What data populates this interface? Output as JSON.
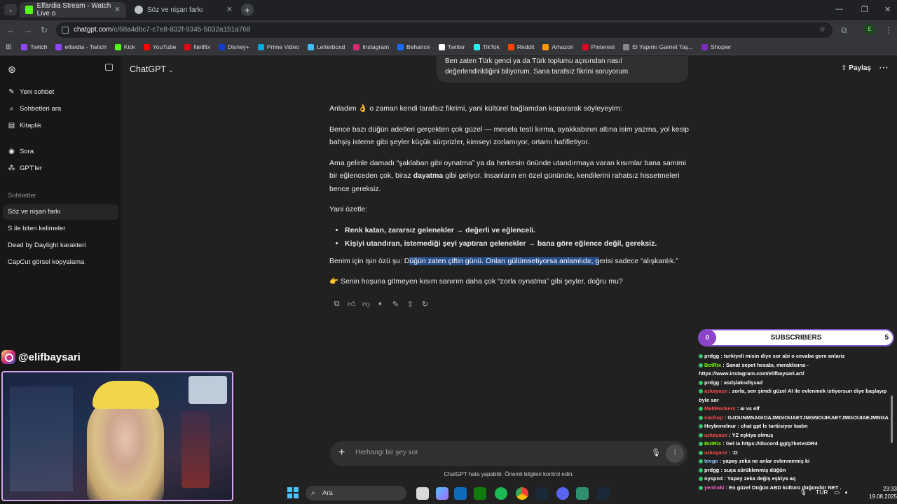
{
  "browser": {
    "tabs": [
      {
        "title": "Elfardia Stream - Watch Live o",
        "active": true
      },
      {
        "title": "Söz ve nişan farkı",
        "active": false
      }
    ],
    "url_host": "chatgpt.com",
    "url_path": "/c/68a4dbc7-c7e8-832f-9345-5032a151a768",
    "profile_initial": "E",
    "bookmarks": [
      {
        "label": "Twitch",
        "color": "#9146ff"
      },
      {
        "label": "elfardia - Twitch",
        "color": "#9146ff"
      },
      {
        "label": "Kick",
        "color": "#53fc18"
      },
      {
        "label": "YouTube",
        "color": "#ff0000"
      },
      {
        "label": "Netflix",
        "color": "#e50914"
      },
      {
        "label": "Disney+",
        "color": "#113ccf"
      },
      {
        "label": "Prime Video",
        "color": "#00a8e1"
      },
      {
        "label": "Letterboxd",
        "color": "#40bcf4"
      },
      {
        "label": "Instagram",
        "color": "#d62976"
      },
      {
        "label": "Behance",
        "color": "#1769ff"
      },
      {
        "label": "Twitter",
        "color": "#ffffff"
      },
      {
        "label": "TikTok",
        "color": "#25f4ee"
      },
      {
        "label": "Reddit",
        "color": "#ff4500"
      },
      {
        "label": "Amazon",
        "color": "#ff9900"
      },
      {
        "label": "Pinterest",
        "color": "#e60023"
      },
      {
        "label": "El Yapımı Garnet Taş...",
        "color": "#888888"
      },
      {
        "label": "Shopier",
        "color": "#7b2cbf"
      }
    ]
  },
  "sidebar": {
    "nav": [
      {
        "label": "Yeni sohbet",
        "icon": "edit"
      },
      {
        "label": "Sohbetleri ara",
        "icon": "search"
      },
      {
        "label": "Kitaplık",
        "icon": "library"
      },
      {
        "label": "Sora",
        "icon": "sora"
      },
      {
        "label": "GPT'ler",
        "icon": "grid"
      }
    ],
    "chats_heading": "Sohbetler",
    "chats": [
      "Söz ve nişan farkı",
      "S ile biten kelimeler",
      "Dead by Daylight karakteri",
      "CapCut görsel kopyalama"
    ]
  },
  "header": {
    "model": "ChatGPT",
    "share": "Paylaş"
  },
  "conversation": {
    "user_message_line1": "Ben zaten Türk genci ya da Türk toplumu açısından nasıl",
    "user_message_line2": "değerlendirildiğini biliyorum. Sana tarafsız fikrini soruyorum",
    "p1": "Anladım 👌 o zaman kendi tarafsız fikrimi, yani kültürel bağlamdan kopararak söyleyeyim:",
    "p2": "Bence bazı düğün adetleri gerçekten çok güzel — mesela testi kırma, ayakkabının altına isim yazma, yol kesip bahşiş isteme gibi şeyler küçük sürprizler, kimseyi zorlamıyor, ortamı hafifletiyor.",
    "p3_a": "Ama gelinle damadı “şaklaban gibi oynatma” ya da herkesin önünde utandırmaya varan kısımlar bana samimi bir eğlenceden çok, biraz ",
    "p3_bold": "dayatma",
    "p3_b": " gibi geliyor. İnsanların en özel gününde, kendilerini rahatsız hissetmeleri bence gereksiz.",
    "p4": "Yani özetle:",
    "bullets": [
      "Renk katan, zararsız gelenekler → değerli ve eğlenceli.",
      "Kişiyi utandıran, istemediği şeyi yaptıran gelenekler → bana göre eğlence değil, gereksiz."
    ],
    "p5_a": "Benim için işin özü şu: D",
    "p5_hl": "üğün zaten çiftin günü. Onları gülümsetiyorsa anlamlıdır, g",
    "p5_b": "erisi sadece “alışkanlık.”",
    "p6": "👉 Senin hoşuna gitmeyen kısım sanırım daha çok “zorla oynatma” gibi şeyler, doğru mu?"
  },
  "composer": {
    "placeholder": "Herhangi bir şey sor",
    "disclaimer": "ChatGPT hata yapabilir. Önemli bilgileri kontrol edin."
  },
  "stream_overlay": {
    "instagram_handle": "@elifbaysari",
    "subscribers_label": "SUBSCRIBERS",
    "subscribers_left": "0",
    "subscribers_right": "5",
    "chat": [
      {
        "user": "prdgg",
        "color": "#ffffff",
        "text": ": turkiyeli misin diye sor abi o cevaba gore anlariz"
      },
      {
        "user": "BotRix",
        "color": "#7cfc00",
        "text": ": Sanat sepet hesabı, meraklısına - https://www.instagram.com/elifbaysari.art/"
      },
      {
        "user": "prdgg",
        "color": "#ffffff",
        "text": ": asdşlaksdlşsad"
      },
      {
        "user": "azkayace",
        "color": "#ff4d4d",
        "text": ": zorla, sen şimdi güzel AI ile evlenmek istiyorsun diye başlayıp öyle sor"
      },
      {
        "user": "MeltRockers",
        "color": "#ff4d4d",
        "text": ": ai vs elf"
      },
      {
        "user": "nachop",
        "color": "#ff4d4d",
        "text": ": GJOUNMSAGIOAJMGIOUAETJMGNOUIKAETJMGOUIAEJMNGA"
      },
      {
        "user": "Heybenelnur",
        "color": "#ffffff",
        "text": ": chat gpt le tartiisiyor kadın"
      },
      {
        "user": "azkayace",
        "color": "#ff4d4d",
        "text": ": YZ eşkiya olmuş"
      },
      {
        "user": "BotRix",
        "color": "#7cfc00",
        "text": ": Gel la https://discord.gg/g7ketvsDR4"
      },
      {
        "user": "azkayace",
        "color": "#ff4d4d",
        "text": ": :D"
      },
      {
        "user": "tevge",
        "color": "#9ad0ff",
        "text": ": yapay zeka ne anlar evlenmemiş ki"
      },
      {
        "user": "prdgg",
        "color": "#ffffff",
        "text": ": suça sürüklenmiş düğün"
      },
      {
        "user": "nyspn4",
        "color": "#ffffff",
        "text": ": Yapay zeka değiş eşkiya aq"
      },
      {
        "user": "yeniraki",
        "color": "#ff66cc",
        "text": ": En güzel Düğün ABD kültürü düğündür NET ."
      }
    ]
  },
  "taskbar": {
    "search": "Ara",
    "lang": "TUR",
    "time": "23:33",
    "date": "19.08.2025"
  }
}
